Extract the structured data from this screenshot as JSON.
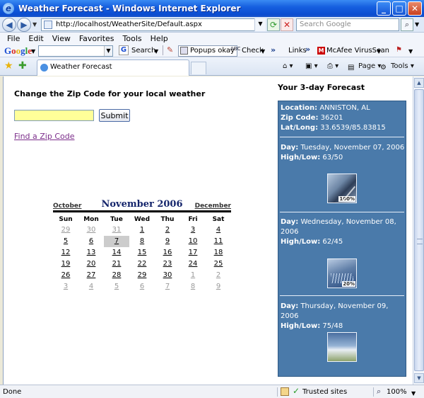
{
  "window": {
    "title": "Weather Forecast - Windows Internet Explorer",
    "buttons": {
      "minimize": "_",
      "maximize": "□",
      "close": "✕"
    }
  },
  "address_bar": {
    "url": "http://localhost/WeatherSite/Default.aspx",
    "search_placeholder": "Search Google"
  },
  "menu": [
    "File",
    "Edit",
    "View",
    "Favorites",
    "Tools",
    "Help"
  ],
  "google_toolbar": {
    "search_label": "Search",
    "popups_label": "Popups okay",
    "abc_label": "ABC",
    "check_label": "Check",
    "links_label": "Links",
    "mcafee_label": "McAfee VirusScan"
  },
  "tab": {
    "title": "Weather Forecast"
  },
  "command_bar": {
    "page_label": "Page",
    "tools_label": "Tools"
  },
  "page": {
    "heading": "Change the Zip Code for your local weather",
    "zip_value": "",
    "submit_label": "Submit",
    "find_zip_link": "Find a Zip Code"
  },
  "calendar": {
    "title": "November 2006",
    "prev_label": "October",
    "next_label": "December",
    "days_of_week": [
      "Sun",
      "Mon",
      "Tue",
      "Wed",
      "Thu",
      "Fri",
      "Sat"
    ],
    "weeks": [
      [
        {
          "d": "29",
          "other": true
        },
        {
          "d": "30",
          "other": true
        },
        {
          "d": "31",
          "other": true
        },
        {
          "d": "1"
        },
        {
          "d": "2"
        },
        {
          "d": "3"
        },
        {
          "d": "4"
        }
      ],
      [
        {
          "d": "5"
        },
        {
          "d": "6"
        },
        {
          "d": "7",
          "today": true
        },
        {
          "d": "8"
        },
        {
          "d": "9"
        },
        {
          "d": "10"
        },
        {
          "d": "11"
        }
      ],
      [
        {
          "d": "12"
        },
        {
          "d": "13"
        },
        {
          "d": "14"
        },
        {
          "d": "15"
        },
        {
          "d": "16"
        },
        {
          "d": "17"
        },
        {
          "d": "18"
        }
      ],
      [
        {
          "d": "19"
        },
        {
          "d": "20"
        },
        {
          "d": "21"
        },
        {
          "d": "22"
        },
        {
          "d": "23"
        },
        {
          "d": "24"
        },
        {
          "d": "25"
        }
      ],
      [
        {
          "d": "26"
        },
        {
          "d": "27"
        },
        {
          "d": "28"
        },
        {
          "d": "29"
        },
        {
          "d": "30"
        },
        {
          "d": "1",
          "other": true
        },
        {
          "d": "2",
          "other": true
        }
      ],
      [
        {
          "d": "3",
          "other": true
        },
        {
          "d": "4",
          "other": true
        },
        {
          "d": "5",
          "other": true
        },
        {
          "d": "6",
          "other": true
        },
        {
          "d": "7",
          "other": true
        },
        {
          "d": "8",
          "other": true
        },
        {
          "d": "9",
          "other": true
        }
      ]
    ]
  },
  "forecast": {
    "title": "Your 3-day Forecast",
    "location_label": "Location:",
    "location": "ANNISTON, AL",
    "zip_label": "Zip Code:",
    "zip": "36201",
    "latlong_label": "Lat/Long:",
    "latlong": "33.6539/85.83815",
    "day_label": "Day:",
    "highlow_label": "High/Low:",
    "days": [
      {
        "day": "Tuesday, November 07, 2006",
        "highlow": "63/50",
        "icon": "storm-icon",
        "precip": "100%"
      },
      {
        "day": "Wednesday, November 08, 2006",
        "highlow": "62/45",
        "icon": "rain-icon",
        "precip": "20%"
      },
      {
        "day": "Thursday, November 09, 2006",
        "highlow": "75/48",
        "icon": "partly-cloudy-icon",
        "precip": ""
      }
    ]
  },
  "status_bar": {
    "status": "Done",
    "zone": "Trusted sites",
    "zoom": "100%"
  }
}
